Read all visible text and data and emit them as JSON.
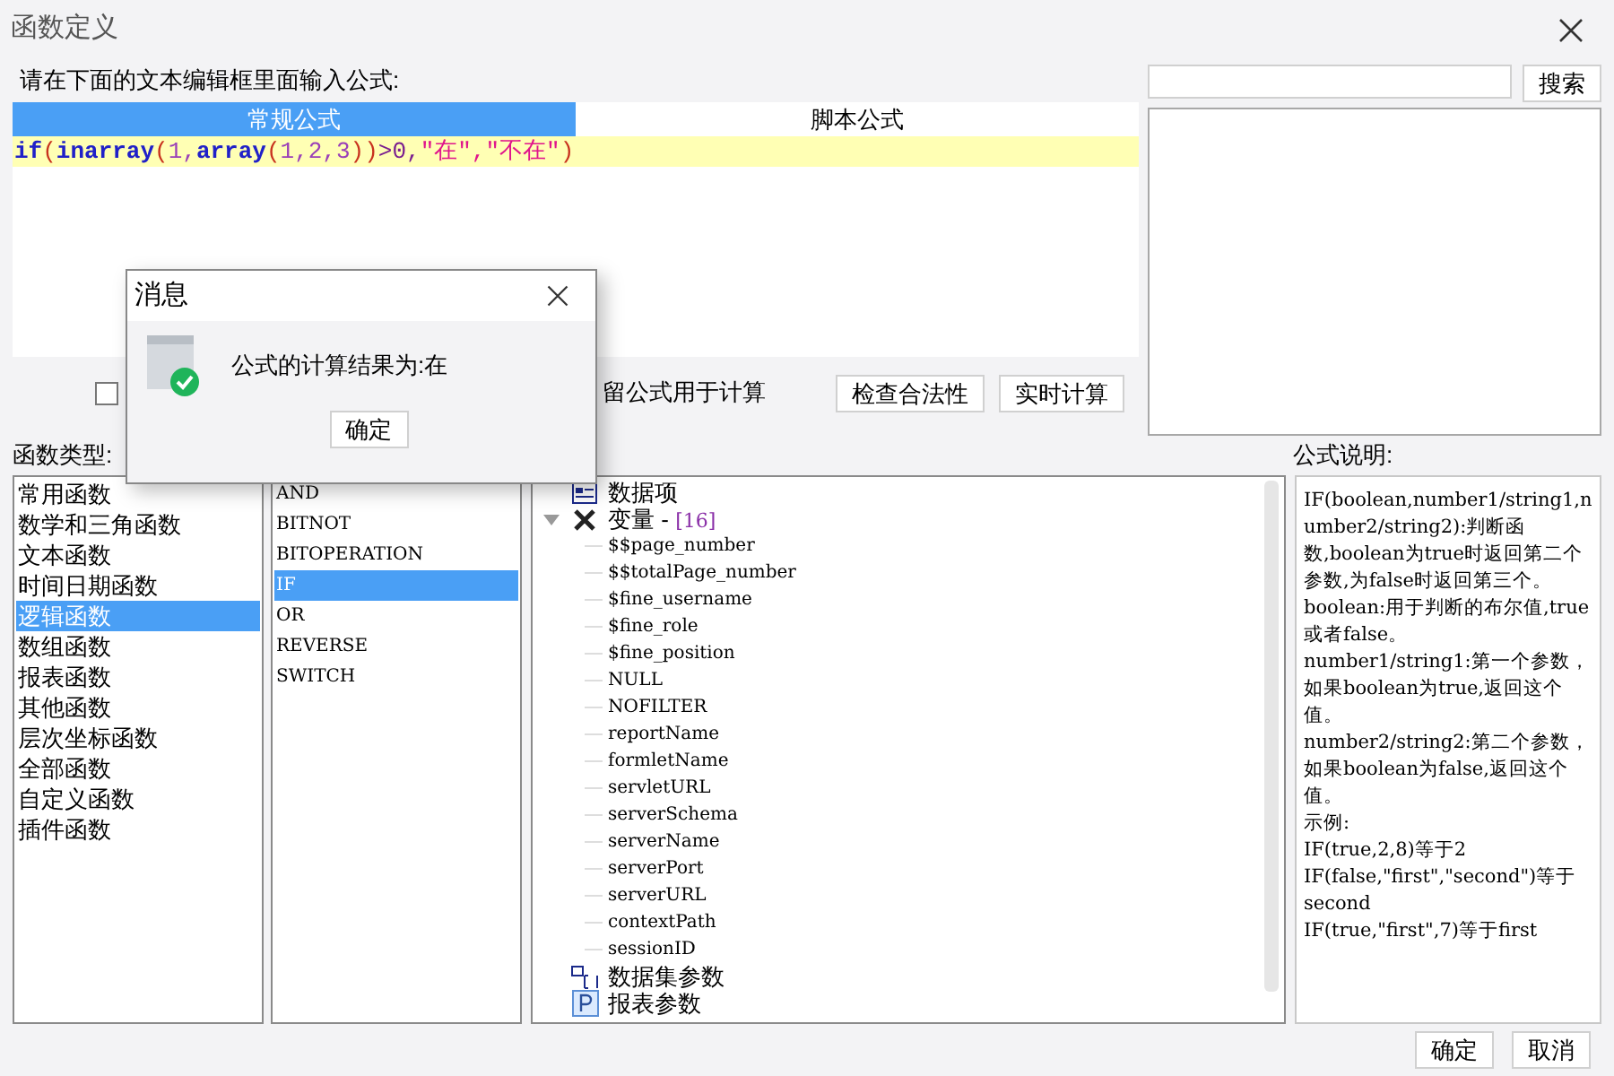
{
  "window": {
    "title": "函数定义"
  },
  "editor": {
    "label": "请在下面的文本编辑框里面输入公式:",
    "tabs": [
      {
        "label": "常规公式",
        "selected": true
      },
      {
        "label": "脚本公式",
        "selected": false
      }
    ],
    "formula": [
      {
        "text": "if",
        "kind": "function"
      },
      {
        "text": "(",
        "kind": "paren"
      },
      {
        "text": "inarray",
        "kind": "function"
      },
      {
        "text": "(",
        "kind": "paren"
      },
      {
        "text": "1,",
        "kind": "number"
      },
      {
        "text": "array",
        "kind": "function"
      },
      {
        "text": "(",
        "kind": "paren"
      },
      {
        "text": "1,2,3",
        "kind": "number"
      },
      {
        "text": "))",
        "kind": "paren"
      },
      {
        "text": ">0,",
        "kind": "operator"
      },
      {
        "text": "\"在\",\"不在\"",
        "kind": "string"
      },
      {
        "text": ")",
        "kind": "paren"
      }
    ]
  },
  "options": {
    "checkbox": {
      "checked": false,
      "label": "留公式用于计算"
    },
    "buttons": [
      "检查合法性",
      "实时计算"
    ]
  },
  "search": {
    "button": "搜索"
  },
  "function_types": {
    "label": "函数类型:",
    "items": [
      {
        "label": "常用函数",
        "selected": false
      },
      {
        "label": "数学和三角函数",
        "selected": false
      },
      {
        "label": "文本函数",
        "selected": false
      },
      {
        "label": "时间日期函数",
        "selected": false
      },
      {
        "label": "逻辑函数",
        "selected": true
      },
      {
        "label": "数组函数",
        "selected": false
      },
      {
        "label": "报表函数",
        "selected": false
      },
      {
        "label": "其他函数",
        "selected": false
      },
      {
        "label": "层次坐标函数",
        "selected": false
      },
      {
        "label": "全部函数",
        "selected": false
      },
      {
        "label": "自定义函数",
        "selected": false
      },
      {
        "label": "插件函数",
        "selected": false
      }
    ]
  },
  "functions": [
    {
      "label": "AND",
      "selected": false
    },
    {
      "label": "BITNOT",
      "selected": false
    },
    {
      "label": "BITOPERATION",
      "selected": false
    },
    {
      "label": "IF",
      "selected": true
    },
    {
      "label": "OR",
      "selected": false
    },
    {
      "label": "REVERSE",
      "selected": false
    },
    {
      "label": "SWITCH",
      "selected": false
    }
  ],
  "tree": [
    {
      "label": "数据项",
      "kind": "data"
    },
    {
      "label": "变量 - ",
      "count": "[16]",
      "kind": "variables",
      "expanded": true,
      "children": [
        {
          "label": "$$page_number"
        },
        {
          "label": "$$totalPage_number"
        },
        {
          "label": "$fine_username"
        },
        {
          "label": "$fine_role"
        },
        {
          "label": "$fine_position"
        },
        {
          "label": "NULL"
        },
        {
          "label": "NOFILTER"
        },
        {
          "label": "reportName"
        },
        {
          "label": "formletName"
        },
        {
          "label": "servletURL"
        },
        {
          "label": "serverSchema"
        },
        {
          "label": "serverName"
        },
        {
          "label": "serverPort"
        },
        {
          "label": "serverURL"
        },
        {
          "label": "contextPath"
        },
        {
          "label": "sessionID"
        }
      ]
    },
    {
      "label": "数据集参数",
      "kind": "dataset"
    },
    {
      "label": "报表参数",
      "kind": "param"
    }
  ],
  "description": {
    "label": "公式说明:",
    "paragraphs": [
      "IF(boolean,number1/string1,number2/string2):判断函数,boolean为true时返回第二个参数,为false时返回第三个。",
      "boolean:用于判断的布尔值,true或者false。",
      "number1/string1:第一个参数，如果boolean为true,返回这个值。",
      "number2/string2:第二个参数，如果boolean为false,返回这个值。",
      "示例:",
      "IF(true,2,8)等于2",
      "IF(false,\"first\",\"second\")等于second",
      "IF(true,\"first\",7)等于first"
    ]
  },
  "footer": {
    "buttons": [
      "确定",
      "取消"
    ]
  },
  "message": {
    "title": "消息",
    "text": "公式的计算结果为:在",
    "button": "确定"
  }
}
